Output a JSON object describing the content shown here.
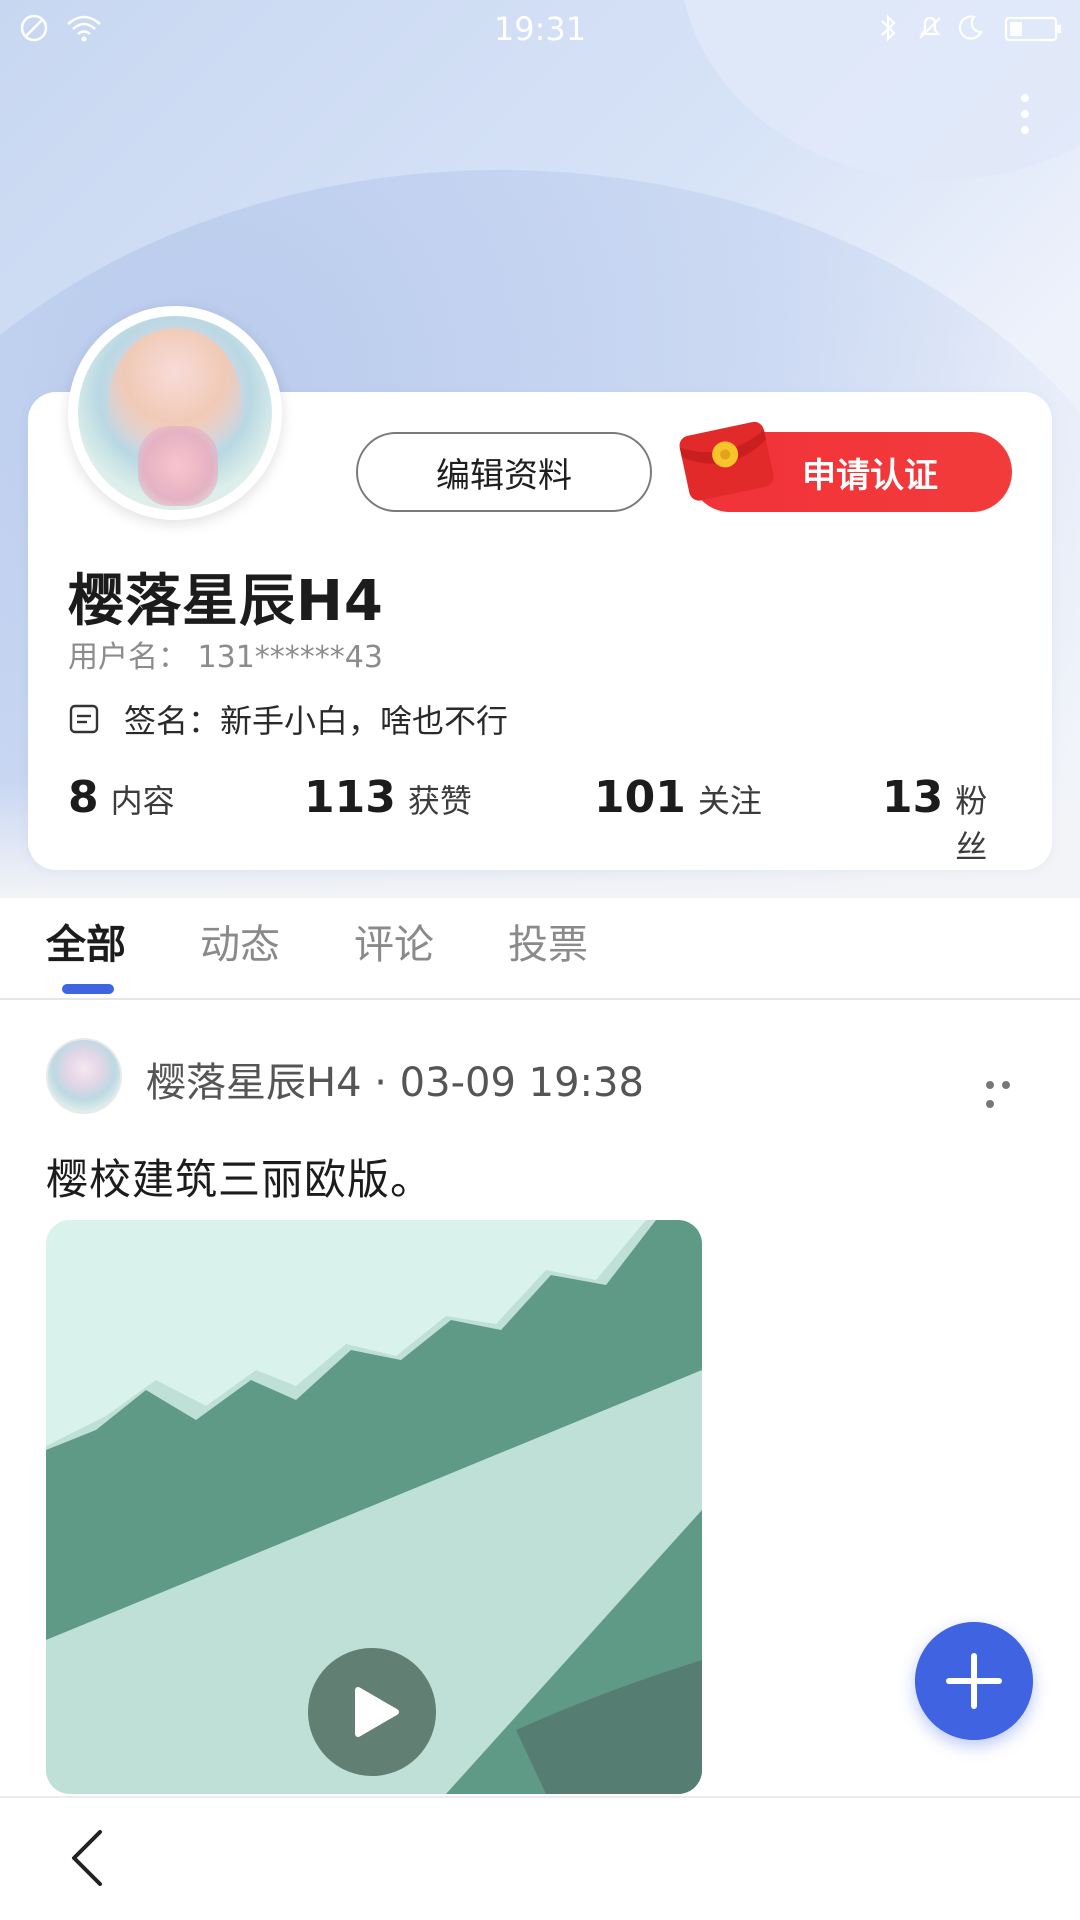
{
  "status_bar": {
    "time": "19:31"
  },
  "profile": {
    "edit_button": "编辑资料",
    "verify_button": "申请认证",
    "name": "樱落星辰H4",
    "username_label": "用户名：",
    "username_value": "131******43",
    "signature": "签名：新手小白，啥也不行",
    "stats": [
      {
        "num": "8",
        "label": "内容"
      },
      {
        "num": "113",
        "label": "获赞"
      },
      {
        "num": "101",
        "label": "关注"
      },
      {
        "num": "13",
        "label": "粉丝"
      }
    ]
  },
  "tabs": [
    "全部",
    "动态",
    "评论",
    "投票"
  ],
  "post": {
    "meta": "樱落星辰H4 · 03-09 19:38",
    "text": "樱校建筑三丽欧版。"
  },
  "colors": {
    "accent": "#3f63e1",
    "verify_red": "#f1323a"
  },
  "icons": {
    "menu": "more-vertical-icon",
    "post_menu": "more-horizontal-icon",
    "play": "play-icon",
    "fab": "plus-icon",
    "back": "chevron-left-icon"
  }
}
